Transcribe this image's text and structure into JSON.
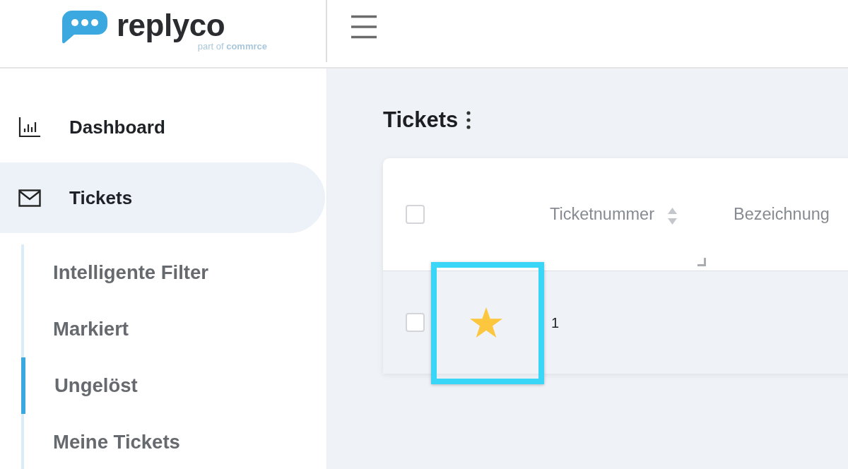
{
  "header": {
    "logo": {
      "name": "replyco",
      "tagline": "part of **commrce**"
    }
  },
  "sidebar": {
    "items": [
      {
        "label": "Dashboard",
        "selected": false
      },
      {
        "label": "Tickets",
        "selected": true,
        "expanded": true,
        "children": [
          {
            "label": "Intelligente Filter",
            "selected": false
          },
          {
            "label": "Markiert",
            "selected": false
          },
          {
            "label": "Ungelöst",
            "selected": true
          },
          {
            "label": "Meine Tickets",
            "selected": false
          }
        ]
      }
    ]
  },
  "page": {
    "title": "Tickets"
  },
  "table": {
    "select_all": {
      "checked": false
    },
    "columns": [
      {
        "label": "Ticketnummer",
        "sortable": true
      },
      {
        "label": "Bezeichnung",
        "sortable": false
      }
    ],
    "rows": [
      {
        "checked": false,
        "starred": true,
        "star_highlighted": true,
        "ticket_number": "1"
      }
    ]
  }
}
